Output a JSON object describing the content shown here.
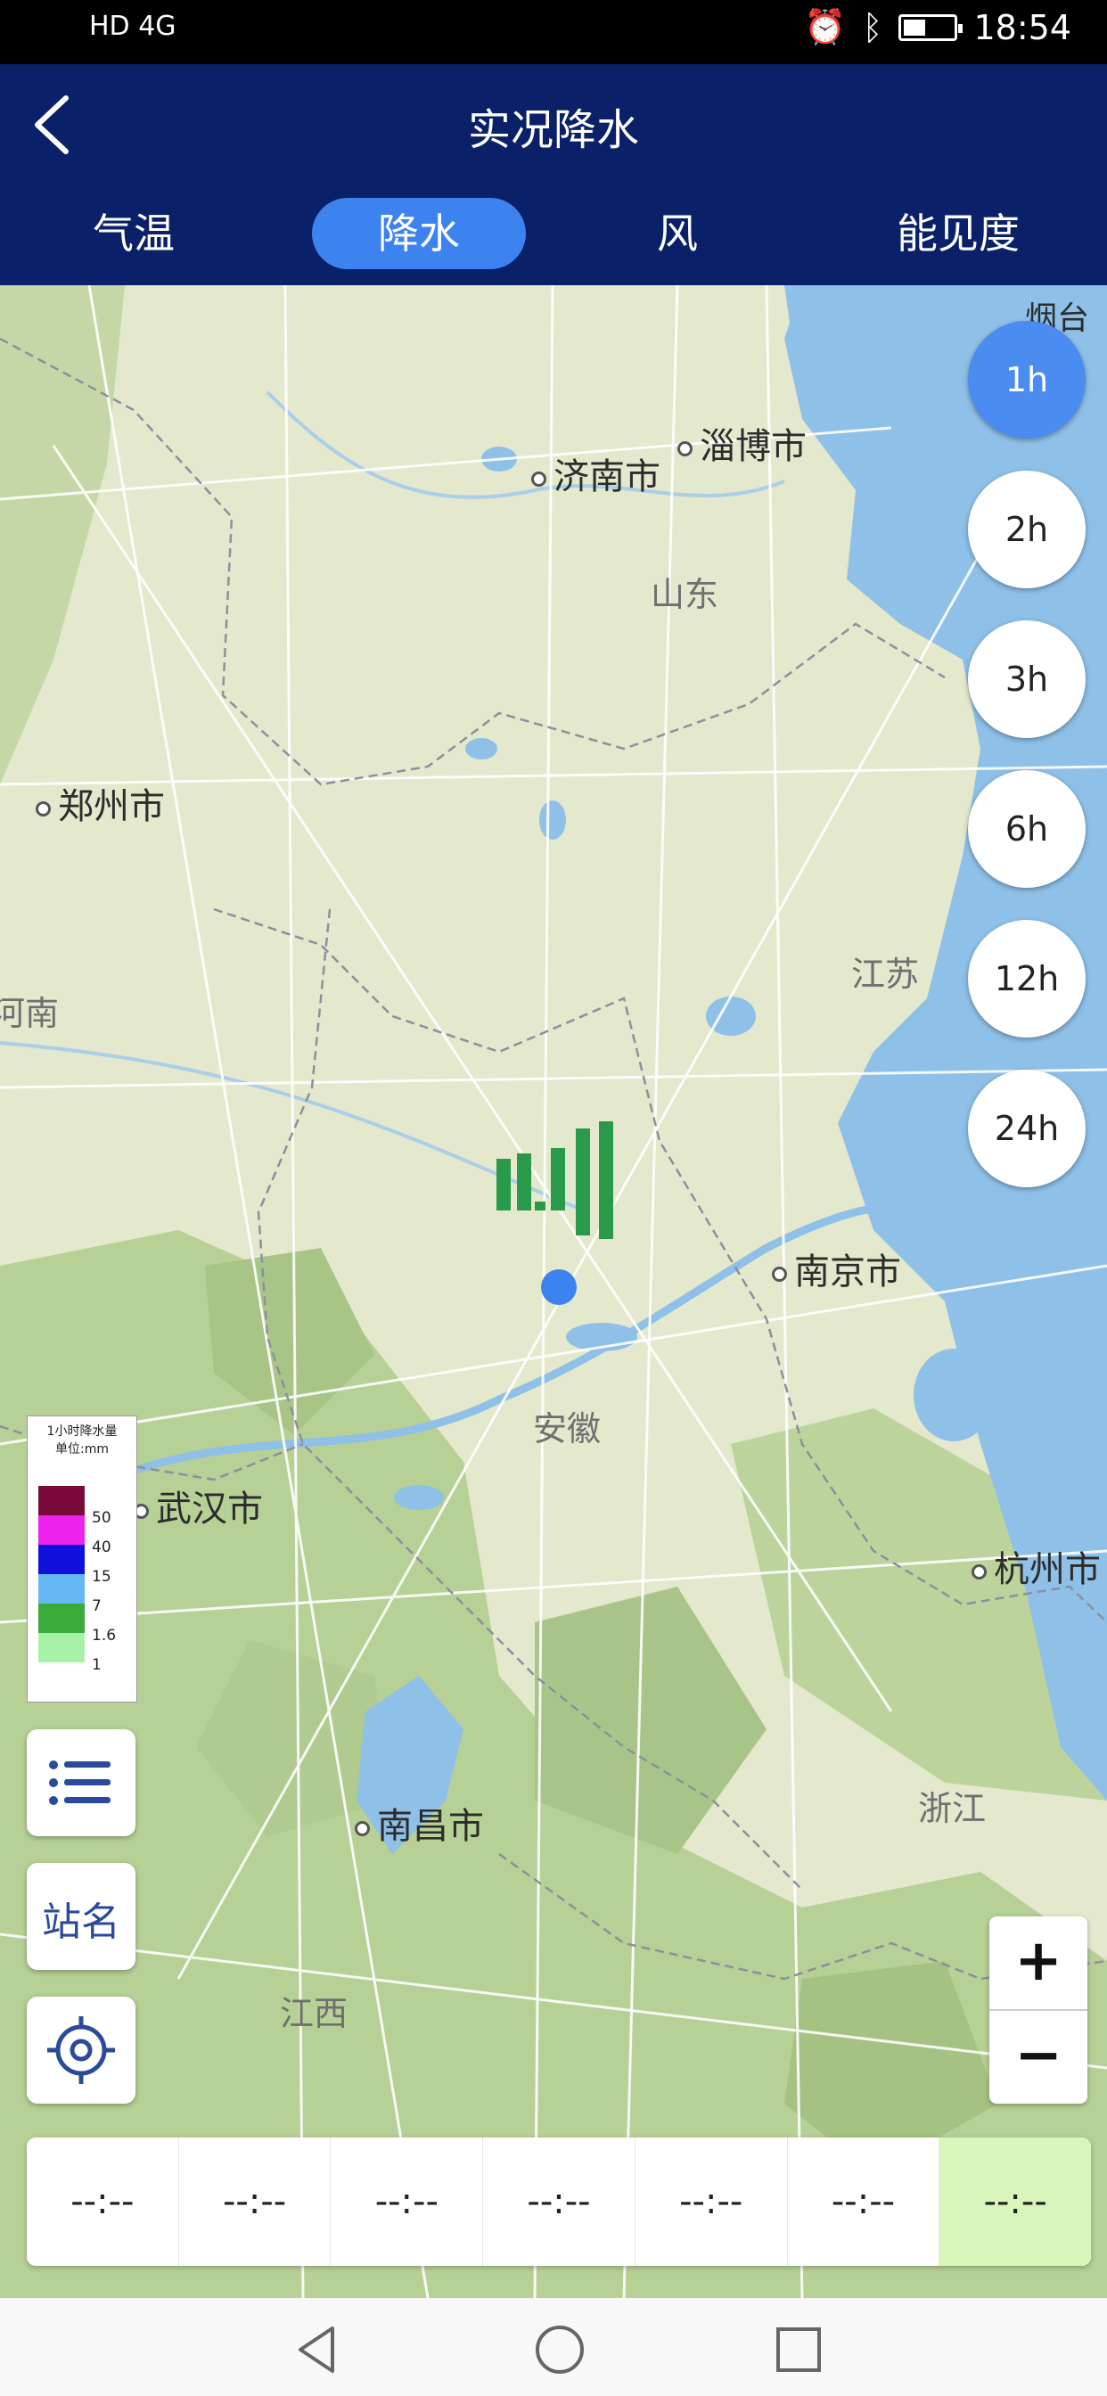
{
  "status_bar": {
    "network": "HD 4G",
    "time": "18:54"
  },
  "header": {
    "title": "实况降水"
  },
  "tabs": [
    {
      "label": "气温",
      "active": false
    },
    {
      "label": "降水",
      "active": true
    },
    {
      "label": "风",
      "active": false
    },
    {
      "label": "能见度",
      "active": false
    }
  ],
  "map": {
    "cities": [
      {
        "name": "淄博市"
      },
      {
        "name": "济南市"
      },
      {
        "name": "郑州市"
      },
      {
        "name": "南京市"
      },
      {
        "name": "武汉市"
      },
      {
        "name": "杭州市"
      },
      {
        "name": "南昌市"
      }
    ],
    "provinces": [
      "山东",
      "江苏",
      "安徽",
      "浙江",
      "江西",
      "河南",
      "烟台"
    ]
  },
  "time_ranges": [
    {
      "label": "1h",
      "active": true
    },
    {
      "label": "2h",
      "active": false
    },
    {
      "label": "3h",
      "active": false
    },
    {
      "label": "6h",
      "active": false
    },
    {
      "label": "12h",
      "active": false
    },
    {
      "label": "24h",
      "active": false
    }
  ],
  "legend": {
    "title": "1小时降水量",
    "unit": "单位:mm",
    "items": [
      {
        "value": "50",
        "color": "#7a0a3a"
      },
      {
        "value": "40",
        "color": "#ee22ee"
      },
      {
        "value": "15",
        "color": "#1010dd"
      },
      {
        "value": "7",
        "color": "#66b8f5"
      },
      {
        "value": "1.6",
        "color": "#3aab3a"
      },
      {
        "value": "1",
        "color": "#a8f2a8"
      }
    ]
  },
  "side_buttons": {
    "station_name": "站名"
  },
  "zoom": {
    "in": "+",
    "out": "−"
  },
  "timeline": [
    "--:--",
    "--:--",
    "--:--",
    "--:--",
    "--:--",
    "--:--",
    "--:--"
  ],
  "colors": {
    "header_bg": "#0a2068",
    "accent": "#3d83f0",
    "rain_bar": "#2a9a4a",
    "timeline_selected": "#daf5b9"
  }
}
